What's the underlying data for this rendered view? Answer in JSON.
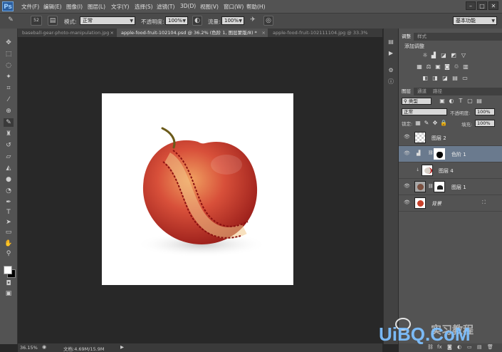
{
  "app": {
    "logo": "Ps"
  },
  "menu": [
    "文件(F)",
    "编辑(E)",
    "图像(I)",
    "图层(L)",
    "文字(Y)",
    "选择(S)",
    "滤镜(T)",
    "3D(D)",
    "视图(V)",
    "窗口(W)",
    "帮助(H)"
  ],
  "options": {
    "brush_size": "52",
    "mode_label": "模式:",
    "mode_value": "正常",
    "opacity_label": "不透明度:",
    "opacity_value": "100%",
    "flow_label": "流量:",
    "flow_value": "100%",
    "workspace": "基本功能"
  },
  "tabs": [
    {
      "label": "baseball-gear-photo-manipulation.jpg",
      "active": false
    },
    {
      "label": "apple-food-fruit-102104.psd @ 36.2% (色阶 1, 图层蒙版/8) *",
      "active": true
    },
    {
      "label": "apple-food-fruit-102111104.jpg @ 33.3%",
      "active": false
    }
  ],
  "status": {
    "zoom": "36.15%",
    "doc_size": "文档:4.69M/15.9M"
  },
  "adjustments": {
    "tabs": [
      "调整",
      "样式"
    ],
    "title": "添加调整"
  },
  "layers_panel": {
    "tabs": [
      "图层",
      "通道",
      "路径"
    ],
    "kind_filter": "类型",
    "blend_mode": "正常",
    "opacity_label": "不透明度:",
    "opacity_value": "100%",
    "lock_label": "锁定:",
    "fill_label": "填充:",
    "fill_value": "100%",
    "layers": [
      {
        "name": "图层 2",
        "selected": false
      },
      {
        "name": "色阶 1",
        "selected": true
      },
      {
        "name": "图层 4",
        "selected": false
      },
      {
        "name": "图层 1",
        "selected": false
      },
      {
        "name": "背景",
        "selected": false
      }
    ]
  },
  "watermark": {
    "cn": "实习教程",
    "brand": "UiBQ.CoM"
  },
  "colors": {
    "ui_dark": "#282828",
    "panel": "#535353",
    "selected_layer": "#6a7a8e",
    "apple_red": "#c8302a",
    "stitch": "#8a1010"
  }
}
